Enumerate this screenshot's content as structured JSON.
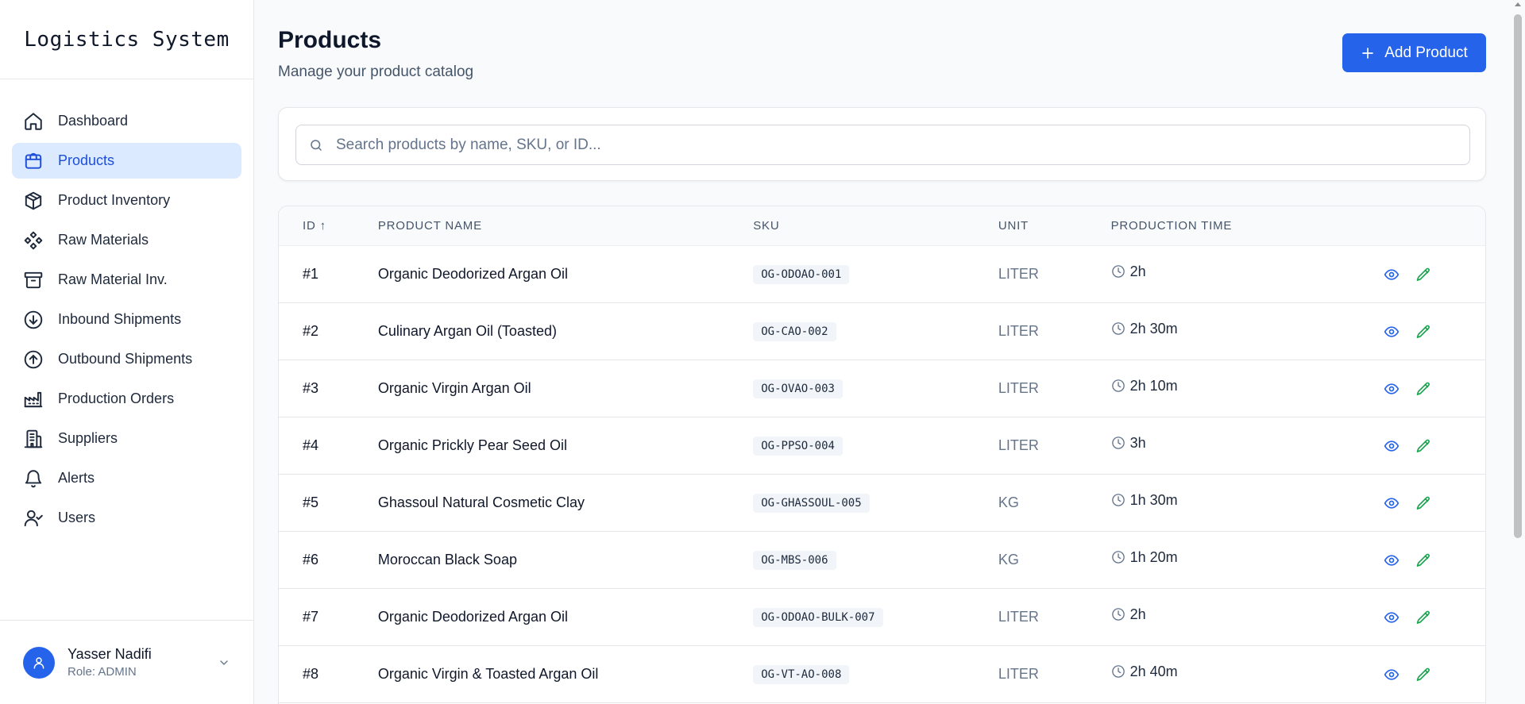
{
  "app": {
    "title": "Logistics System"
  },
  "nav": [
    {
      "label": "Dashboard",
      "icon": "home-icon",
      "active": false
    },
    {
      "label": "Products",
      "icon": "shopping-bag-icon",
      "active": true
    },
    {
      "label": "Product Inventory",
      "icon": "package-icon",
      "active": false
    },
    {
      "label": "Raw Materials",
      "icon": "component-icon",
      "active": false
    },
    {
      "label": "Raw Material Inv.",
      "icon": "archive-icon",
      "active": false
    },
    {
      "label": "Inbound Shipments",
      "icon": "arrow-down-circle-icon",
      "active": false
    },
    {
      "label": "Outbound Shipments",
      "icon": "arrow-up-circle-icon",
      "active": false
    },
    {
      "label": "Production Orders",
      "icon": "factory-icon",
      "active": false
    },
    {
      "label": "Suppliers",
      "icon": "building-icon",
      "active": false
    },
    {
      "label": "Alerts",
      "icon": "bell-icon",
      "active": false
    },
    {
      "label": "Users",
      "icon": "user-check-icon",
      "active": false
    }
  ],
  "user": {
    "name": "Yasser Nadifi",
    "role": "Role: ADMIN"
  },
  "page": {
    "title": "Products",
    "subtitle": "Manage your product catalog",
    "add_button": "Add Product"
  },
  "search": {
    "placeholder": "Search products by name, SKU, or ID..."
  },
  "table": {
    "columns": {
      "id": "ID ↑",
      "name": "PRODUCT NAME",
      "sku": "SKU",
      "unit": "UNIT",
      "time": "PRODUCTION TIME"
    },
    "rows": [
      {
        "id": "#1",
        "name": "Organic Deodorized Argan Oil",
        "sku": "OG-ODOAO-001",
        "unit": "LITER",
        "time": "2h"
      },
      {
        "id": "#2",
        "name": "Culinary Argan Oil (Toasted)",
        "sku": "OG-CAO-002",
        "unit": "LITER",
        "time": "2h 30m"
      },
      {
        "id": "#3",
        "name": "Organic Virgin Argan Oil",
        "sku": "OG-OVAO-003",
        "unit": "LITER",
        "time": "2h 10m"
      },
      {
        "id": "#4",
        "name": "Organic Prickly Pear Seed Oil",
        "sku": "OG-PPSO-004",
        "unit": "LITER",
        "time": "3h"
      },
      {
        "id": "#5",
        "name": "Ghassoul Natural Cosmetic Clay",
        "sku": "OG-GHASSOUL-005",
        "unit": "KG",
        "time": "1h 30m"
      },
      {
        "id": "#6",
        "name": "Moroccan Black Soap",
        "sku": "OG-MBS-006",
        "unit": "KG",
        "time": "1h 20m"
      },
      {
        "id": "#7",
        "name": "Organic Deodorized Argan Oil",
        "sku": "OG-ODOAO-BULK-007",
        "unit": "LITER",
        "time": "2h"
      },
      {
        "id": "#8",
        "name": "Organic Virgin & Toasted Argan Oil",
        "sku": "OG-VT-AO-008",
        "unit": "LITER",
        "time": "2h 40m"
      }
    ]
  },
  "colors": {
    "primary": "#2563eb",
    "active_bg": "#dbeafe",
    "active_text": "#1d4ed8",
    "edit": "#16a34a"
  }
}
